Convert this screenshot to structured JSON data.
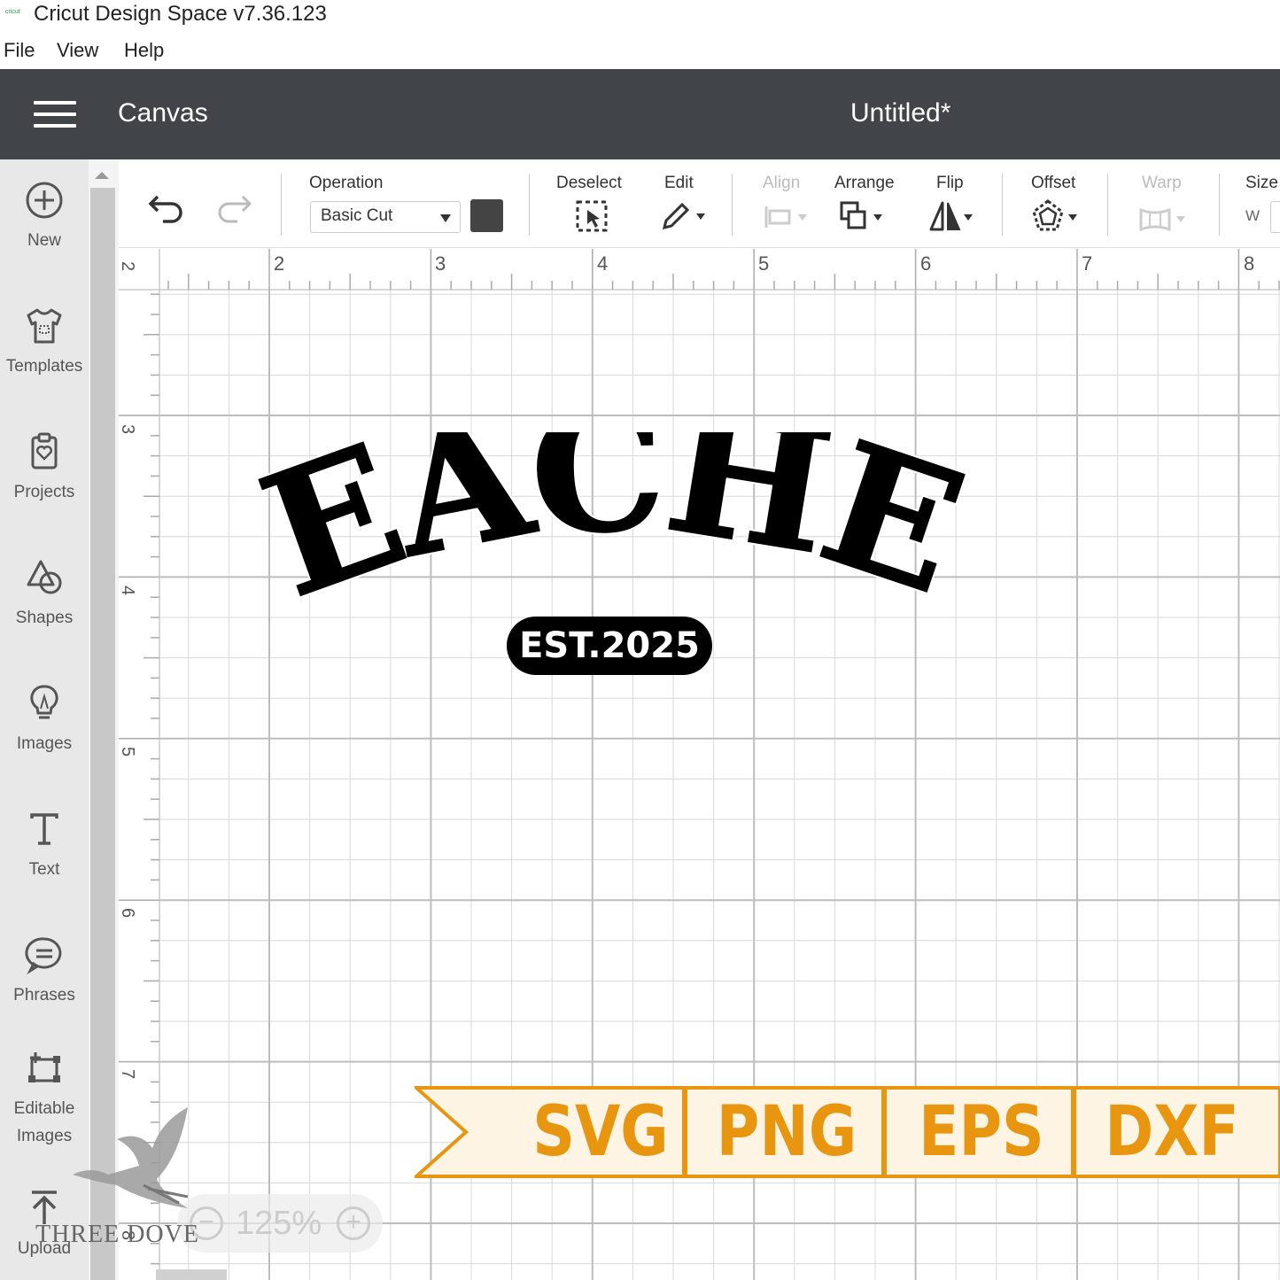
{
  "window": {
    "app_logo": "cricut",
    "title": "Cricut Design Space  v7.36.123"
  },
  "menu": {
    "items": [
      "File",
      "View",
      "Help"
    ]
  },
  "header": {
    "title": "Canvas",
    "document": "Untitled*"
  },
  "sidebar": {
    "items": [
      {
        "label": "New",
        "icon": "plus-circle-icon"
      },
      {
        "label": "Templates",
        "icon": "shirt-icon"
      },
      {
        "label": "Projects",
        "icon": "clipboard-heart-icon"
      },
      {
        "label": "Shapes",
        "icon": "shapes-icon"
      },
      {
        "label": "Images",
        "icon": "lightbulb-icon"
      },
      {
        "label": "Text",
        "icon": "text-t-icon"
      },
      {
        "label": "Phrases",
        "icon": "speech-bubble-icon"
      },
      {
        "label": "Editable",
        "label2": "Images",
        "icon": "editable-image-icon"
      },
      {
        "label": "Upload",
        "icon": "upload-icon"
      }
    ]
  },
  "toolbar": {
    "operation_label": "Operation",
    "operation_value": "Basic Cut",
    "operation_color": "#444444",
    "deselect_label": "Deselect",
    "edit_label": "Edit",
    "align_label": "Align",
    "arrange_label": "Arrange",
    "flip_label": "Flip",
    "offset_label": "Offset",
    "warp_label": "Warp",
    "size_label": "Size",
    "size_w_label": "W"
  },
  "ruler": {
    "horizontal": [
      "2",
      "3",
      "4",
      "5",
      "6",
      "7",
      "8"
    ],
    "vertical": [
      "2",
      "3",
      "4",
      "5",
      "6",
      "7",
      "8"
    ]
  },
  "design": {
    "main_text": "TEACHER",
    "sub_text": "EST.2025"
  },
  "formats": [
    "SVG",
    "PNG",
    "EPS",
    "DXF"
  ],
  "format_color": "#e8950f",
  "zoom": {
    "value": "125%",
    "minus": "−",
    "plus": "+"
  },
  "watermark": "THREE DOVE"
}
